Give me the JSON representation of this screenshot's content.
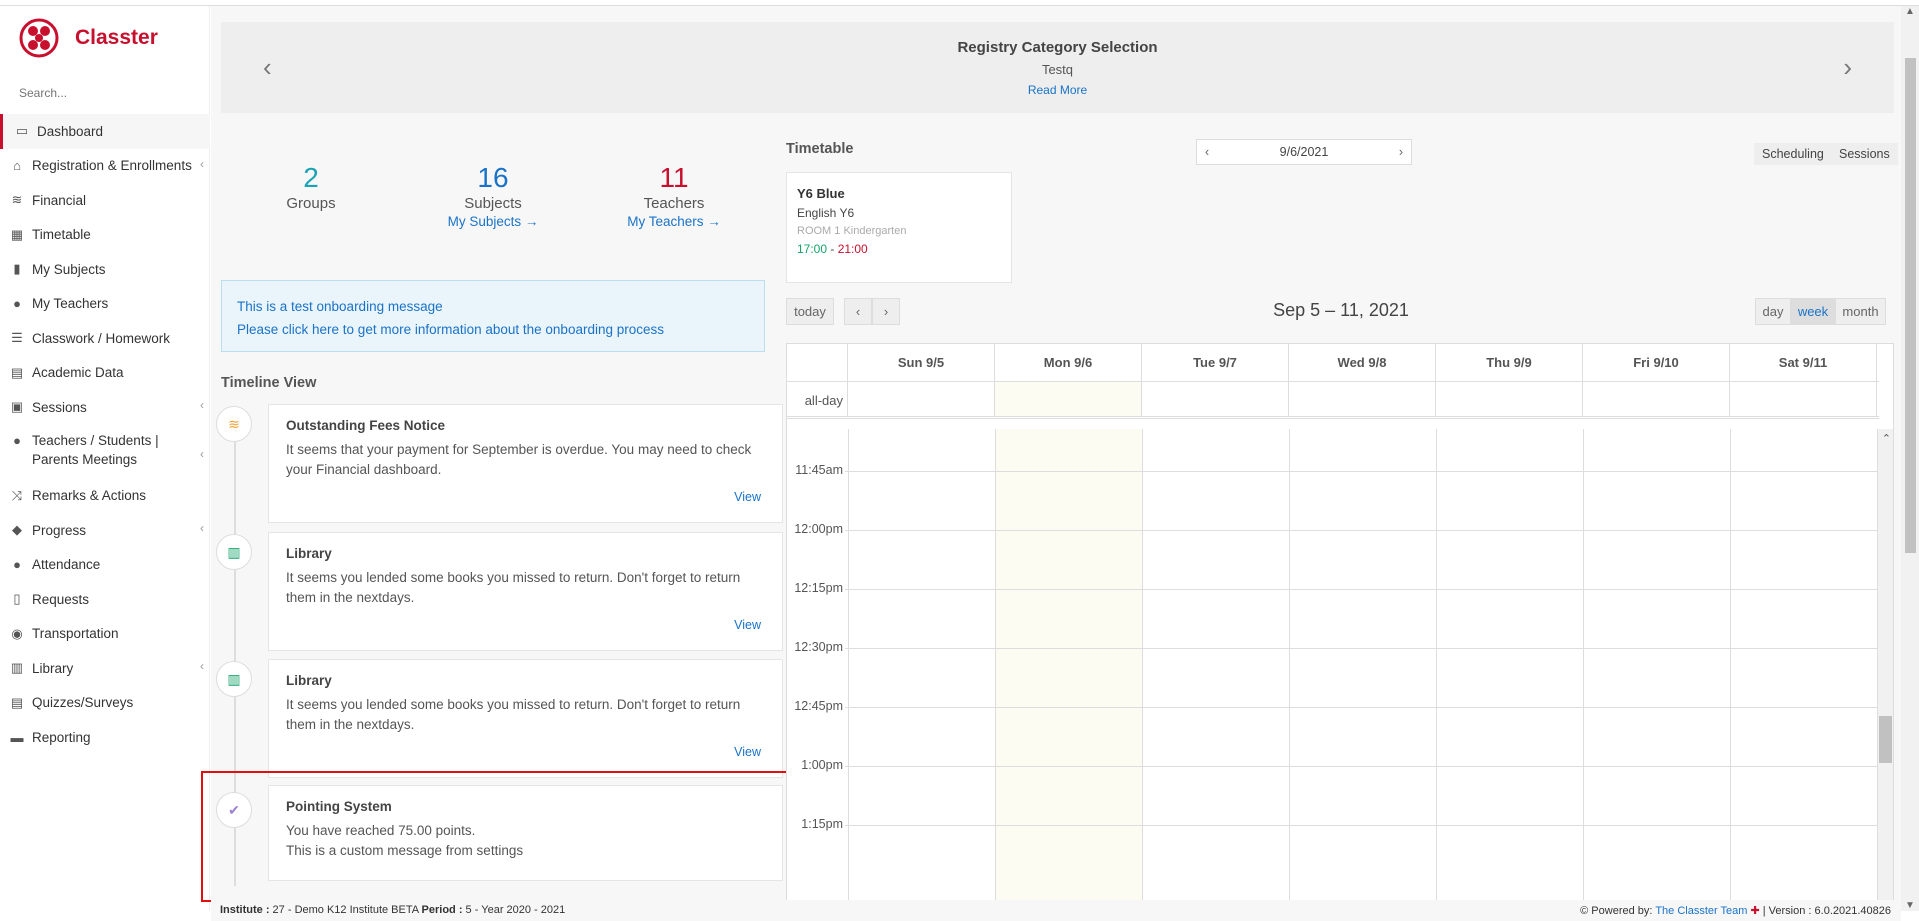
{
  "app": {
    "name": "Classter",
    "brand_color": "#c8102e",
    "link_color": "#1a73c8"
  },
  "search": {
    "placeholder": "Search..."
  },
  "sidebar": {
    "items": [
      {
        "label": "Dashboard",
        "icon": "laptop-icon",
        "active": true
      },
      {
        "label": "Registration & Enrollments",
        "icon": "institution-icon",
        "has_submenu": true
      },
      {
        "label": "Financial",
        "icon": "coins-icon"
      },
      {
        "label": "Timetable",
        "icon": "calendar-icon"
      },
      {
        "label": "My Subjects",
        "icon": "book-icon"
      },
      {
        "label": "My Teachers",
        "icon": "users-icon"
      },
      {
        "label": "Classwork / Homework",
        "icon": "list-icon"
      },
      {
        "label": "Academic Data",
        "icon": "chart-icon"
      },
      {
        "label": "Sessions",
        "icon": "presentation-icon",
        "has_submenu": true
      },
      {
        "label": "Teachers / Students | Parents Meetings",
        "icon": "meeting-icon",
        "has_submenu": true
      },
      {
        "label": "Remarks & Actions",
        "icon": "shuffle-icon"
      },
      {
        "label": "Progress",
        "icon": "graduation-cap-icon",
        "has_submenu": true
      },
      {
        "label": "Attendance",
        "icon": "user-x-icon"
      },
      {
        "label": "Requests",
        "icon": "document-icon"
      },
      {
        "label": "Transportation",
        "icon": "bus-icon"
      },
      {
        "label": "Library",
        "icon": "library-icon",
        "has_submenu": true
      },
      {
        "label": "Quizzes/Surveys",
        "icon": "quiz-icon"
      },
      {
        "label": "Reporting",
        "icon": "printer-icon"
      }
    ]
  },
  "carousel": {
    "title": "Registry Category Selection",
    "subtitle": "Testq",
    "link": "Read More"
  },
  "stats": [
    {
      "value": "2",
      "label": "Groups",
      "link": "",
      "color": "#1aa3b5"
    },
    {
      "value": "16",
      "label": "Subjects",
      "link": "My Subjects  →",
      "color": "#1a73c8"
    },
    {
      "value": "11",
      "label": "Teachers",
      "link": "My Teachers  →",
      "color": "#c8102e"
    }
  ],
  "onboarding": {
    "line1": "This is a test onboarding message",
    "line2": "Please click here to get more information about the onboarding process"
  },
  "timeline": {
    "title": "Timeline View",
    "items": [
      {
        "title": "Outstanding Fees Notice",
        "body": "It seems that your payment for September is overdue. You may need to check your Financial dashboard.",
        "action": "View",
        "icon": "coins-icon",
        "icon_color": "#f0a030"
      },
      {
        "title": "Library",
        "body": "It seems you lended some books you missed to return. Don't forget to return them in the nextdays.",
        "action": "View",
        "icon": "library-icon",
        "icon_color": "#15a36a"
      },
      {
        "title": "Library",
        "body": "It seems you lended some books you missed to return. Don't forget to return them in the nextdays.",
        "action": "View",
        "icon": "library-icon",
        "icon_color": "#15a36a"
      },
      {
        "title": "Pointing System",
        "body": "You have reached 75.00 points.",
        "body2": "This is a custom message from settings",
        "action": "",
        "icon": "check-badge-icon",
        "icon_color": "#9b7fd4"
      }
    ]
  },
  "timetable": {
    "title": "Timetable",
    "date": "9/6/2021",
    "buttons": {
      "scheduling": "Scheduling",
      "sessions": "Sessions"
    },
    "session": {
      "group": "Y6 Blue",
      "subject": "English Y6",
      "room": "ROOM 1 Kindergarten",
      "start": "17:00",
      "sep": " - ",
      "end": "21:00"
    }
  },
  "calendar": {
    "today": "today",
    "prev": "‹",
    "next": "›",
    "range": "Sep 5 – 11, 2021",
    "views": {
      "day": "day",
      "week": "week",
      "month": "month"
    },
    "allday": "all-day",
    "days": [
      "Sun 9/5",
      "Mon 9/6",
      "Tue 9/7",
      "Wed 9/8",
      "Thu 9/9",
      "Fri 9/10",
      "Sat 9/11"
    ],
    "times": [
      "",
      "11:45am",
      "12:00pm",
      "12:15pm",
      "12:30pm",
      "12:45pm",
      "1:00pm",
      "1:15pm"
    ]
  },
  "footer": {
    "institute_label": "Institute :",
    "institute_value": " 27 - Demo K12 Institute BETA ",
    "period_label": "Period :",
    "period_value": " 5 - Year 2020 - 2021",
    "powered": "Powered by: ",
    "team": "The Classter Team",
    "version": " | Version : 6.0.2021.40826"
  }
}
